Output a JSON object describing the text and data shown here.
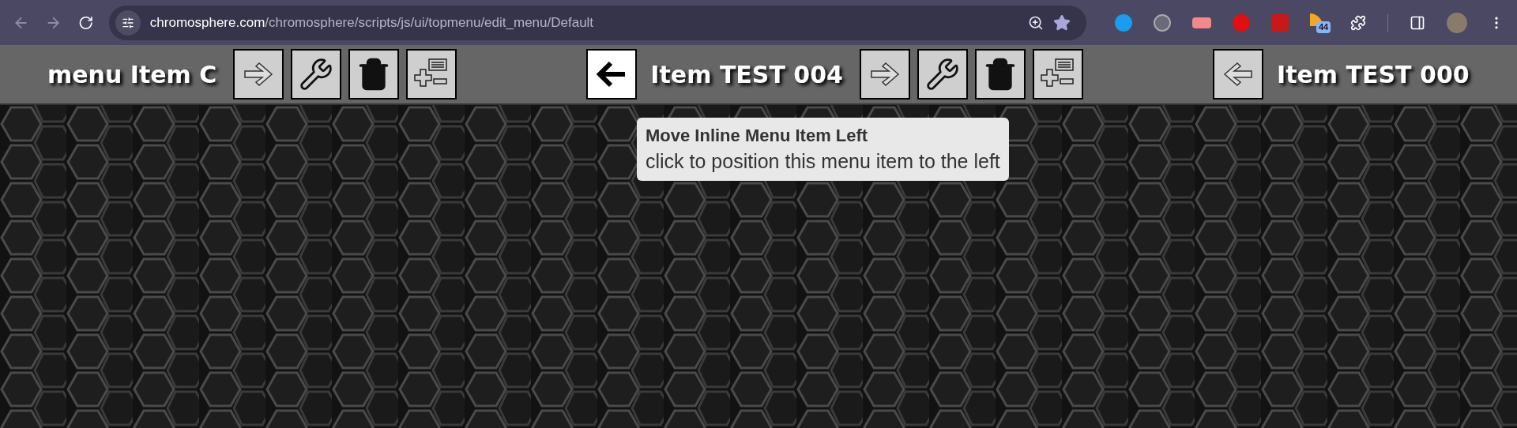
{
  "browser": {
    "url_host": "chromosphere.com",
    "url_path": "/chromosphere/scripts/js/ui/topmenu/edit_menu/Default",
    "bookmarked": true,
    "extension_badge": "44"
  },
  "menu_items": [
    {
      "label": "menu Item C",
      "right_buttons": [
        {
          "kind": "move-right",
          "highlighted": false
        },
        {
          "kind": "edit",
          "highlighted": false
        },
        {
          "kind": "delete",
          "highlighted": false
        },
        {
          "kind": "add",
          "highlighted": false
        }
      ]
    },
    {
      "label": "Item TEST 004",
      "left_buttons": [
        {
          "kind": "move-left",
          "highlighted": true
        }
      ],
      "right_buttons": [
        {
          "kind": "move-right",
          "highlighted": false
        },
        {
          "kind": "edit",
          "highlighted": false
        },
        {
          "kind": "delete",
          "highlighted": false
        },
        {
          "kind": "add",
          "highlighted": false
        }
      ]
    },
    {
      "label": "Item TEST 000",
      "left_buttons": [
        {
          "kind": "move-left",
          "highlighted": false
        }
      ]
    }
  ],
  "tooltip": {
    "title": "Move Inline Menu Item Left",
    "text": "click to position this menu item to the left"
  }
}
